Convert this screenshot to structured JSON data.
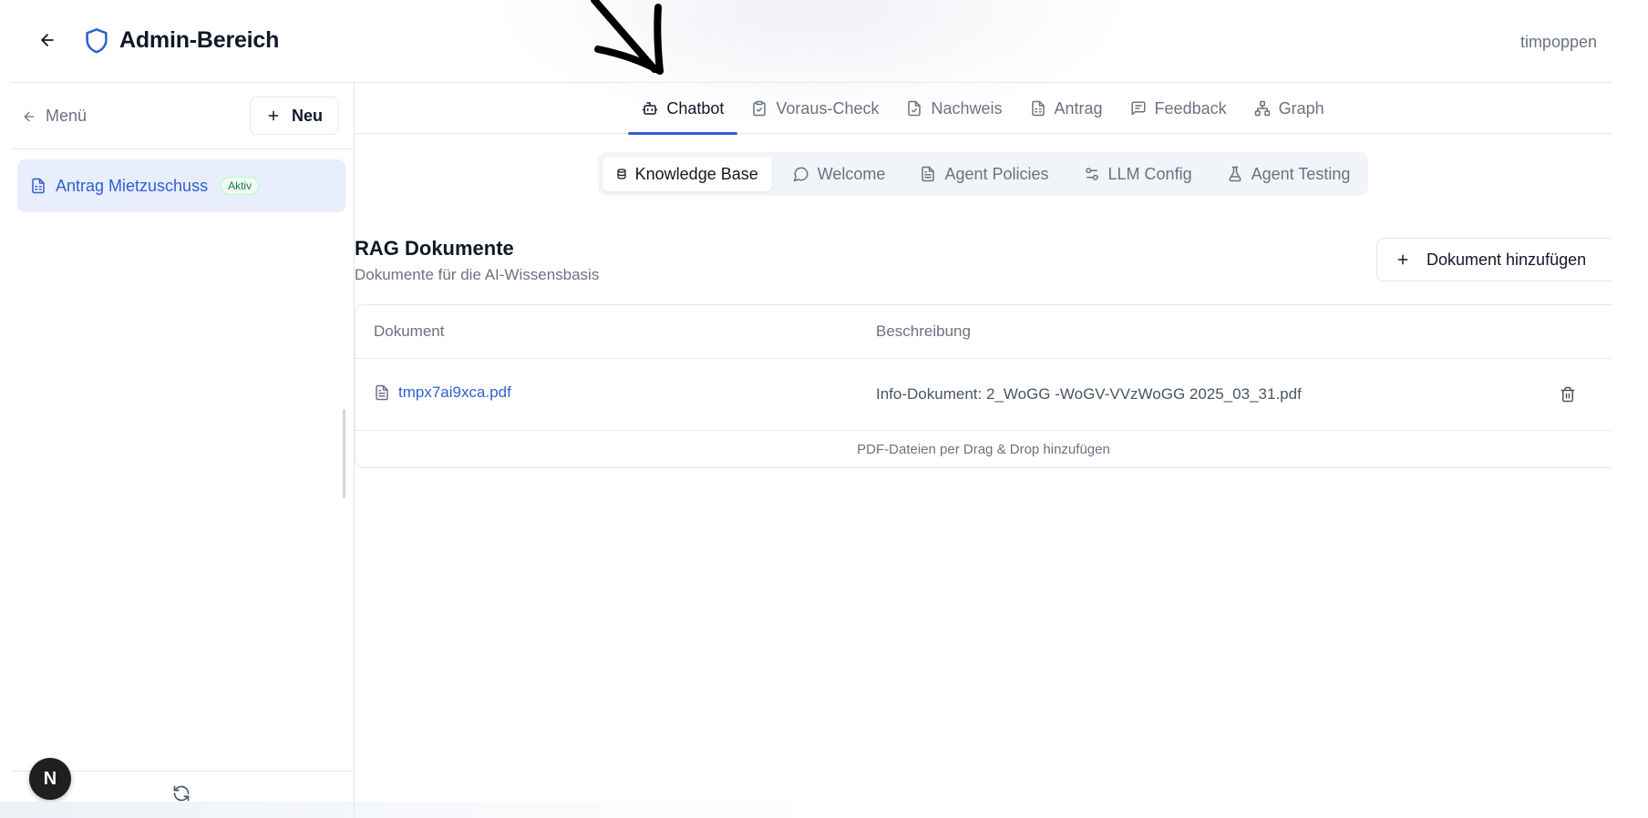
{
  "header": {
    "title": "Admin-Bereich",
    "username": "timpoppen"
  },
  "sidebar": {
    "menu_label": "Menü",
    "new_label": "Neu",
    "items": [
      {
        "label": "Antrag Mietzuschuss",
        "badge": "Aktiv"
      }
    ],
    "avatar_letter": "N"
  },
  "top_tabs": [
    {
      "label": "Chatbot",
      "icon": "bot-icon",
      "active": true
    },
    {
      "label": "Voraus-Check",
      "icon": "clipboard-check-icon",
      "active": false
    },
    {
      "label": "Nachweis",
      "icon": "file-check-icon",
      "active": false
    },
    {
      "label": "Antrag",
      "icon": "file-text-icon",
      "active": false
    },
    {
      "label": "Feedback",
      "icon": "message-square-icon",
      "active": false
    },
    {
      "label": "Graph",
      "icon": "network-icon",
      "active": false
    }
  ],
  "sub_tabs": [
    {
      "label": "Knowledge Base",
      "icon": "database-icon",
      "active": true
    },
    {
      "label": "Welcome",
      "icon": "message-circle-icon",
      "active": false
    },
    {
      "label": "Agent Policies",
      "icon": "file-text-icon",
      "active": false
    },
    {
      "label": "LLM Config",
      "icon": "sliders-icon",
      "active": false
    },
    {
      "label": "Agent Testing",
      "icon": "flask-icon",
      "active": false
    }
  ],
  "section": {
    "title": "RAG Dokumente",
    "subtitle": "Dokumente für die AI-Wissensbasis",
    "add_button": "Dokument hinzufügen"
  },
  "table": {
    "columns": [
      "Dokument",
      "Beschreibung"
    ],
    "rows": [
      {
        "document": "tmpx7ai9xca.pdf",
        "description": "Info-Dokument: 2_WoGG -WoGV-VVzWoGG 2025_03_31.pdf"
      }
    ],
    "drop_hint": "PDF-Dateien per Drag & Drop hinzufügen"
  },
  "colors": {
    "accent": "#3b5bdb",
    "link": "#2f5fd0",
    "active_item_bg": "#e8eefb",
    "badge_green": "#15803d"
  }
}
